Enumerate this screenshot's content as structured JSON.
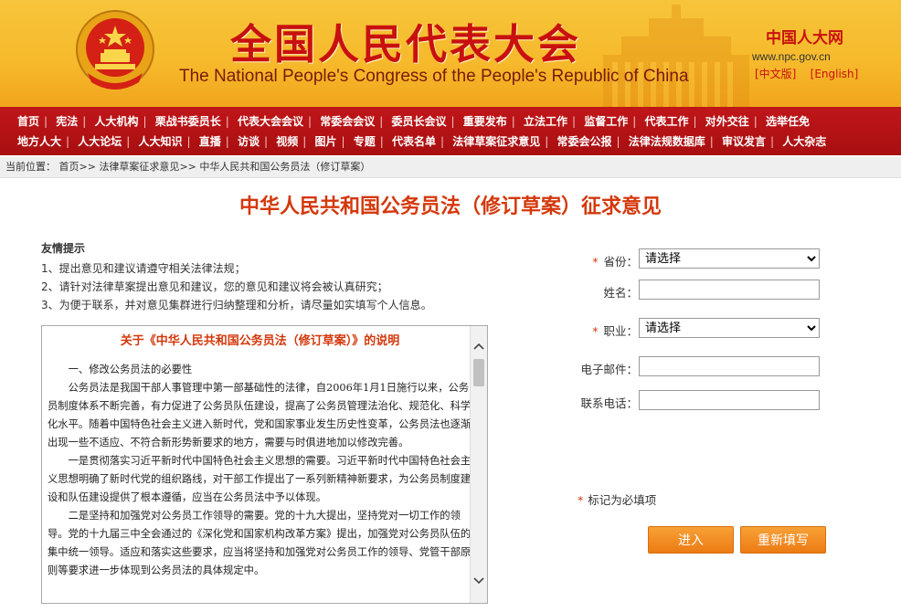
{
  "header": {
    "title_cn": "全国人民代表大会",
    "title_en": "The National People's Congress of the People's Republic of China",
    "site_name": "中国人大网",
    "site_url": "www.npc.gov.cn",
    "lang_cn": "[中文版]",
    "lang_en": "[English]"
  },
  "nav": {
    "row1": [
      "首页",
      "宪法",
      "人大机构",
      "栗战书委员长",
      "代表大会会议",
      "常委会会议",
      "委员长会议",
      "重要发布",
      "立法工作",
      "监督工作",
      "代表工作",
      "对外交往",
      "选举任免"
    ],
    "row2": [
      "地方人大",
      "人大论坛",
      "人大知识",
      "直播",
      "访谈",
      "视频",
      "图片",
      "专题",
      "代表名单",
      "法律草案征求意见",
      "常委会公报",
      "法律法规数据库",
      "审议发言",
      "人大杂志"
    ]
  },
  "breadcrumb": {
    "prefix": "当前位置：",
    "home": "首页",
    "section": "法律草案征求意见",
    "current": "中华人民共和国公务员法（修订草案）"
  },
  "page_title": "中华人民共和国公务员法（修订草案）征求意见",
  "tips": {
    "title": "友情提示",
    "items": [
      "1、提出意见和建议请遵守相关法律法规；",
      "2、请针对法律草案提出意见和建议，您的意见和建议将会被认真研究；",
      "3、为便于联系，并对意见集群进行归纳整理和分析，请尽量如实填写个人信息。"
    ]
  },
  "doc": {
    "title": "关于《中华人民共和国公务员法（修订草案）》的说明",
    "paragraphs": [
      "　　一、修改公务员法的必要性",
      "　　公务员法是我国干部人事管理中第一部基础性的法律，自2006年1月1日施行以来，公务员制度体系不断完善，有力促进了公务员队伍建设，提高了公务员管理法治化、规范化、科学化水平。随着中国特色社会主义进入新时代，党和国家事业发生历史性变革，公务员法也逐渐出现一些不适应、不符合新形势新要求的地方，需要与时俱进地加以修改完善。",
      "　　一是贯彻落实习近平新时代中国特色社会主义思想的需要。习近平新时代中国特色社会主义思想明确了新时代党的组织路线，对干部工作提出了一系列新精神新要求，为公务员制度建设和队伍建设提供了根本遵循，应当在公务员法中予以体现。",
      "　　二是坚持和加强党对公务员工作领导的需要。党的十九大提出，坚持党对一切工作的领导。党的十九届三中全会通过的《深化党和国家机构改革方案》提出，加强党对公务员队伍的集中统一领导。适应和落实这些要求，应当将坚持和加强党对公务员工作的领导、党管干部原则等要求进一步体现到公务员法的具体规定中。"
    ]
  },
  "form": {
    "province_label": "省份：",
    "province_value": "请选择",
    "name_label": "姓名：",
    "job_label": "职业：",
    "job_value": "请选择",
    "email_label": "电子邮件：",
    "phone_label": "联系电话：",
    "required_mark": "*",
    "required_note": "标记为必填项",
    "submit_label": "进入",
    "reset_label": "重新填写"
  },
  "colors": {
    "header_bg": "#f6b92b",
    "nav_bg": "#b31212",
    "title_red": "#d4380b",
    "button_orange": "#ec7b13"
  }
}
